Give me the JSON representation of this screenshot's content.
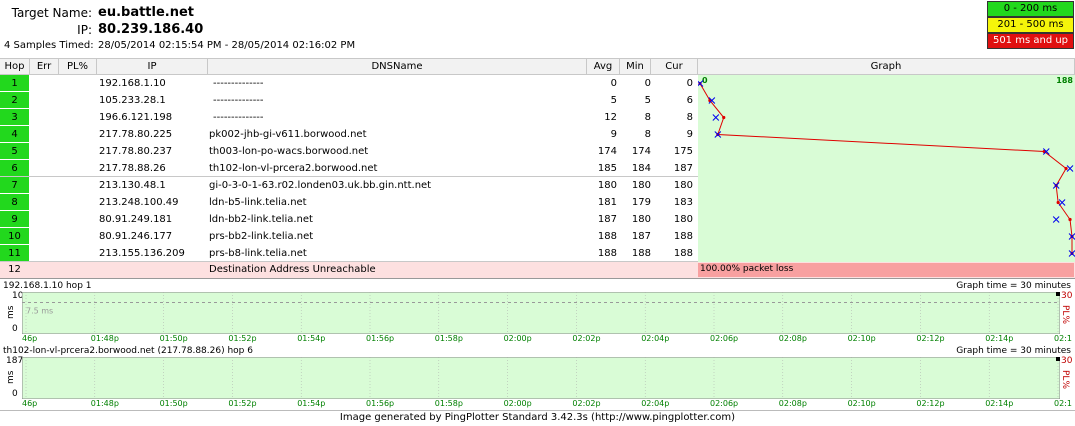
{
  "header": {
    "target_label": "Target Name:",
    "target_value": "eu.battle.net",
    "ip_label": "IP:",
    "ip_value": "80.239.186.40",
    "samples_label": "4 Samples Timed:",
    "samples_value": "28/05/2014 02:15:54 PM - 28/05/2014 02:16:02 PM"
  },
  "legend": [
    {
      "label": "0 - 200 ms",
      "color": "#22d81d",
      "text_color": "#000000"
    },
    {
      "label": "201 - 500 ms",
      "color": "#f5f50a",
      "text_color": "#000000"
    },
    {
      "label": "501 ms and up",
      "color": "#e01010",
      "text_color": "#ffffff"
    }
  ],
  "columns": {
    "hop": "Hop",
    "err": "Err",
    "pl": "PL%",
    "ip": "IP",
    "dns": "DNSName",
    "avg": "Avg",
    "min": "Min",
    "cur": "Cur",
    "graph": "Graph"
  },
  "graph_scale": {
    "min_label": "0",
    "max_label": "188",
    "max": 188
  },
  "hops": [
    {
      "hop": "1",
      "ip": "192.168.1.10",
      "dns": "--------------",
      "avg": "0",
      "min": "0",
      "cur": "0",
      "avg_ms": 0,
      "cur_ms": 0
    },
    {
      "hop": "2",
      "ip": "105.233.28.1",
      "dns": "--------------",
      "avg": "5",
      "min": "5",
      "cur": "6",
      "avg_ms": 5,
      "cur_ms": 6
    },
    {
      "hop": "3",
      "ip": "196.6.121.198",
      "dns": "--------------",
      "avg": "12",
      "min": "8",
      "cur": "8",
      "avg_ms": 12,
      "cur_ms": 8
    },
    {
      "hop": "4",
      "ip": "217.78.80.225",
      "dns": "pk002-jhb-gi-v611.borwood.net",
      "avg": "9",
      "min": "8",
      "cur": "9",
      "avg_ms": 9,
      "cur_ms": 9
    },
    {
      "hop": "5",
      "ip": "217.78.80.237",
      "dns": "th003-lon-po-wacs.borwood.net",
      "avg": "174",
      "min": "174",
      "cur": "175",
      "avg_ms": 174,
      "cur_ms": 175
    },
    {
      "hop": "6",
      "ip": "217.78.88.26",
      "dns": "th102-lon-vl-prcera2.borwood.net",
      "avg": "185",
      "min": "184",
      "cur": "187",
      "avg_ms": 185,
      "cur_ms": 187
    },
    {
      "hop": "7",
      "ip": "213.130.48.1",
      "dns": "gi-0-3-0-1-63.r02.londen03.uk.bb.gin.ntt.net",
      "avg": "180",
      "min": "180",
      "cur": "180",
      "avg_ms": 180,
      "cur_ms": 180
    },
    {
      "hop": "8",
      "ip": "213.248.100.49",
      "dns": "ldn-b5-link.telia.net",
      "avg": "181",
      "min": "179",
      "cur": "183",
      "avg_ms": 181,
      "cur_ms": 183
    },
    {
      "hop": "9",
      "ip": "80.91.249.181",
      "dns": "ldn-bb2-link.telia.net",
      "avg": "187",
      "min": "180",
      "cur": "180",
      "avg_ms": 187,
      "cur_ms": 180
    },
    {
      "hop": "10",
      "ip": "80.91.246.177",
      "dns": "prs-bb2-link.telia.net",
      "avg": "188",
      "min": "187",
      "cur": "188",
      "avg_ms": 188,
      "cur_ms": 188
    },
    {
      "hop": "11",
      "ip": "213.155.136.209",
      "dns": "prs-b8-link.telia.net",
      "avg": "188",
      "min": "188",
      "cur": "188",
      "avg_ms": 188,
      "cur_ms": 188
    }
  ],
  "unreachable": {
    "hop": "12",
    "message": "Destination Address Unreachable",
    "packet_loss": "100.00% packet loss"
  },
  "timeline1": {
    "title": "192.168.1.10 hop 1",
    "graph_time": "Graph time = 30 minutes",
    "y_max": "10",
    "y_min": "0",
    "y_unit": "ms",
    "pl_max": "30",
    "pl_unit": "PL%",
    "marker_label": "7.5 ms",
    "marker_value_ms": 7.5,
    "y_max_value": 10
  },
  "timeline2": {
    "title": "th102-lon-vl-prcera2.borwood.net (217.78.88.26) hop 6",
    "graph_time": "Graph time = 30 minutes",
    "y_max": "187",
    "y_min": "0",
    "y_unit": "ms",
    "pl_max": "30",
    "pl_unit": "PL%"
  },
  "time_ticks": [
    "46p",
    "01:48p",
    "01:50p",
    "01:52p",
    "01:54p",
    "01:56p",
    "01:58p",
    "02:00p",
    "02:02p",
    "02:04p",
    "02:06p",
    "02:08p",
    "02:10p",
    "02:12p",
    "02:14p",
    "02:1"
  ],
  "footer": "Image generated by PingPlotter Standard 3.42.3s (http://www.pingplotter.com)",
  "colors": {
    "graph_bg": "#d9fcd6",
    "hop_green": "#22d81d",
    "unreachable_row": "#fde0e0",
    "packet_loss_bar": "#f8a0a0",
    "line": "#e00000",
    "marker": "#0000ee"
  }
}
